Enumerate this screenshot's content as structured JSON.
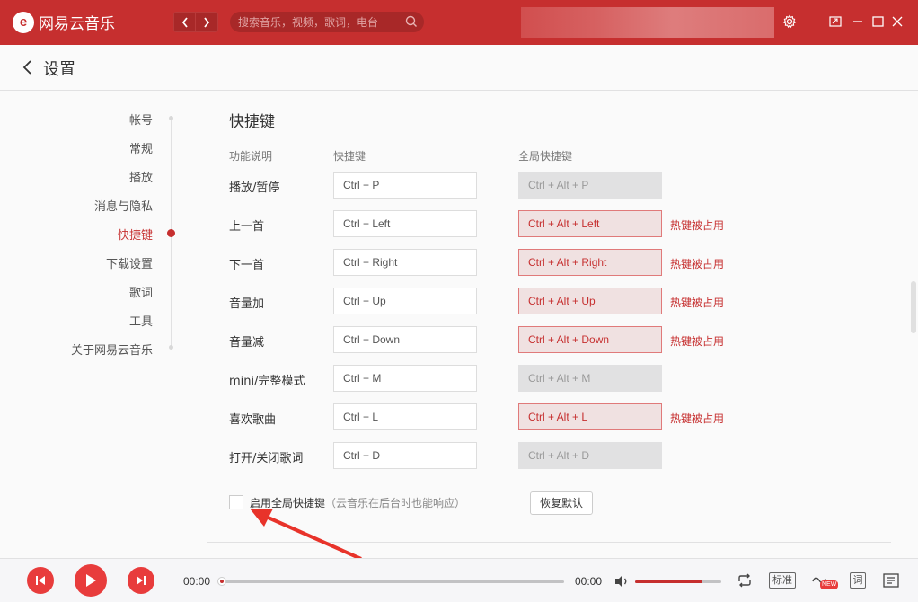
{
  "app": {
    "logo_glyph": "e",
    "title": "网易云音乐"
  },
  "search": {
    "placeholder": "搜索音乐，视频，歌词，电台"
  },
  "header": {
    "title": "设置"
  },
  "sidebar": {
    "items": [
      {
        "label": "帐号"
      },
      {
        "label": "常规"
      },
      {
        "label": "播放"
      },
      {
        "label": "消息与隐私"
      },
      {
        "label": "快捷键"
      },
      {
        "label": "下载设置"
      },
      {
        "label": "歌词"
      },
      {
        "label": "工具"
      },
      {
        "label": "关于网易云音乐"
      }
    ],
    "active_index": 4
  },
  "shortcuts": {
    "title": "快捷键",
    "columns": {
      "function": "功能说明",
      "shortcut": "快捷键",
      "global": "全局快捷键"
    },
    "rows": [
      {
        "label": "播放/暂停",
        "shortcut": "Ctrl + P",
        "global": "Ctrl + Alt + P",
        "conflict": false,
        "conflict_text": ""
      },
      {
        "label": "上一首",
        "shortcut": "Ctrl + Left",
        "global": "Ctrl + Alt + Left",
        "conflict": true,
        "conflict_text": "热键被占用"
      },
      {
        "label": "下一首",
        "shortcut": "Ctrl + Right",
        "global": "Ctrl + Alt + Right",
        "conflict": true,
        "conflict_text": "热键被占用"
      },
      {
        "label": "音量加",
        "shortcut": "Ctrl + Up",
        "global": "Ctrl + Alt + Up",
        "conflict": true,
        "conflict_text": "热键被占用"
      },
      {
        "label": "音量减",
        "shortcut": "Ctrl + Down",
        "global": "Ctrl + Alt + Down",
        "conflict": true,
        "conflict_text": "热键被占用"
      },
      {
        "label": "mini/完整模式",
        "shortcut": "Ctrl + M",
        "global": "Ctrl + Alt + M",
        "conflict": false,
        "conflict_text": ""
      },
      {
        "label": "喜欢歌曲",
        "shortcut": "Ctrl + L",
        "global": "Ctrl + Alt + L",
        "conflict": true,
        "conflict_text": "热键被占用"
      },
      {
        "label": "打开/关闭歌词",
        "shortcut": "Ctrl + D",
        "global": "Ctrl + Alt + D",
        "conflict": false,
        "conflict_text": ""
      }
    ],
    "enable_global_label": "启用全局快捷键",
    "enable_global_hint": "（云音乐在后台时也能响应）",
    "enable_global_checked": false,
    "reset_label": "恢复默认"
  },
  "player": {
    "current_time": "00:00",
    "total_time": "00:00",
    "progress": 0,
    "volume": 0.78,
    "quality_label": "标准",
    "new_badge": "NEW",
    "lyric_label": "词"
  },
  "colors": {
    "brand": "#c62f2f",
    "conflict": "#c62f2f",
    "player_button": "#e83c3c"
  }
}
